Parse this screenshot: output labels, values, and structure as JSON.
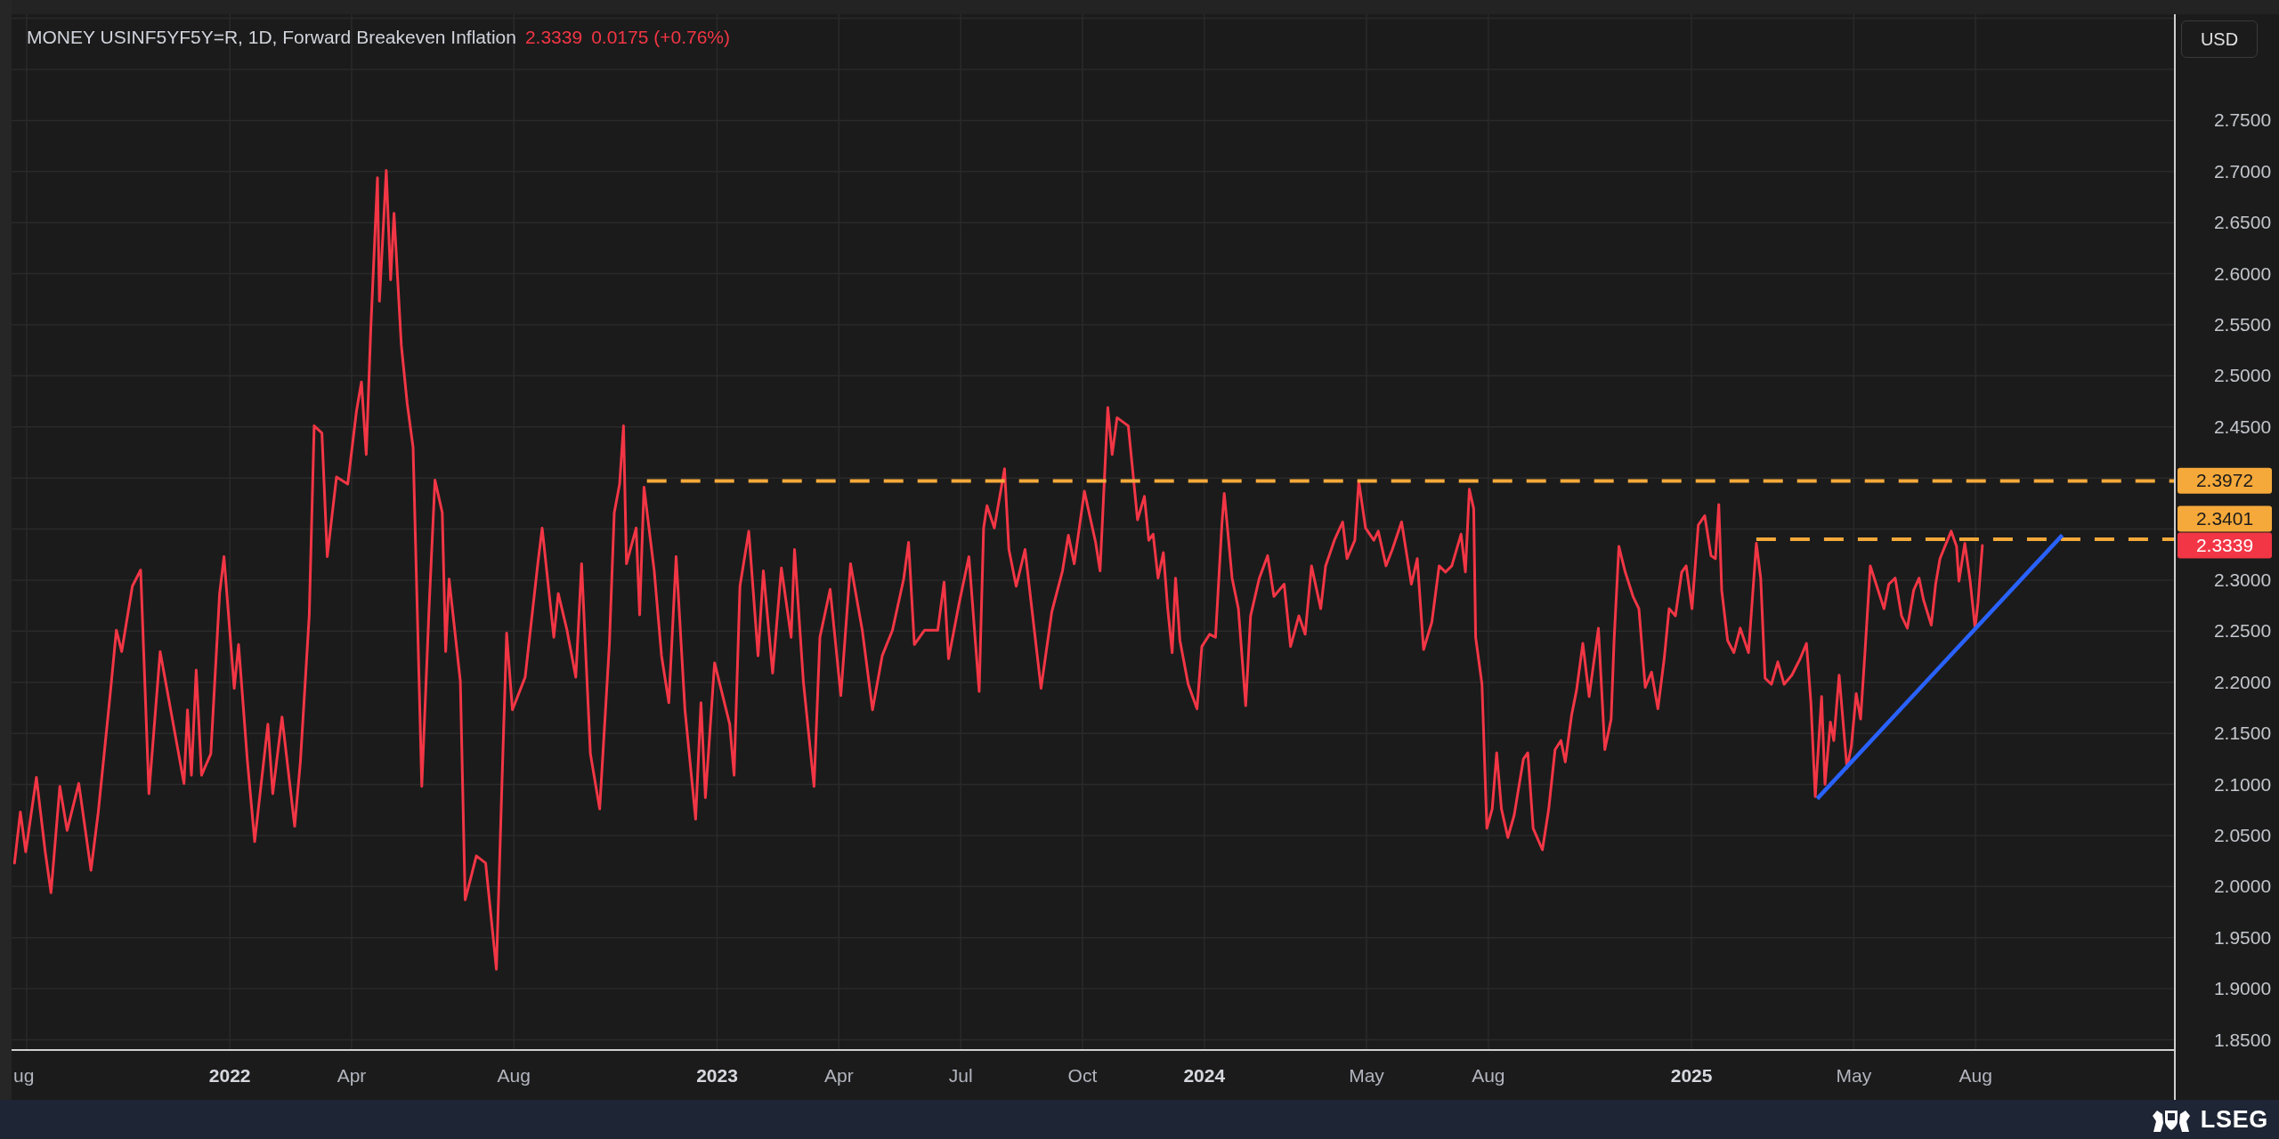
{
  "header": {
    "title": "MONEY USINF5YF5Y=R, 1D, Forward Breakeven Inflation",
    "last": "2.3339",
    "change": "0.0175 (+0.76%)"
  },
  "currency_button": "USD",
  "chart": {
    "chart_data": {
      "type": "line",
      "x": [
        2021.558,
        2021.57,
        2021.581,
        2021.603,
        2021.621,
        2021.633,
        2021.651,
        2021.666,
        2021.69,
        2021.715,
        2021.73,
        2021.755,
        2021.767,
        2021.778,
        2021.8,
        2021.817,
        2021.834,
        2021.857,
        2021.876,
        2021.906,
        2021.913,
        2021.921,
        2021.931,
        2021.942,
        2021.961,
        2021.979,
        2021.988,
        2022.009,
        2022.018,
        2022.036,
        2022.051,
        2022.078,
        2022.088,
        2022.107,
        2022.133,
        2022.145,
        2022.163,
        2022.173,
        2022.189,
        2022.2,
        2022.219,
        2022.242,
        2022.26,
        2022.27,
        2022.28,
        2022.289,
        2022.303,
        2022.307,
        2022.321,
        2022.33,
        2022.337,
        2022.352,
        2022.364,
        2022.376,
        2022.394,
        2022.409,
        2022.421,
        2022.436,
        2022.443,
        2022.45,
        2022.473,
        2022.483,
        2022.506,
        2022.525,
        2022.547,
        2022.558,
        2022.568,
        2022.58,
        2022.606,
        2022.632,
        2022.641,
        2022.665,
        2022.674,
        2022.692,
        2022.71,
        2022.722,
        2022.74,
        2022.759,
        2022.779,
        2022.789,
        2022.8,
        2022.808,
        2022.814,
        2022.834,
        2022.841,
        2022.85,
        2022.871,
        2022.886,
        2022.901,
        2022.916,
        2022.934,
        2022.956,
        2022.967,
        2022.976,
        2022.995,
        2023.026,
        2023.035,
        2023.047,
        2023.065,
        2023.084,
        2023.095,
        2023.114,
        2023.132,
        2023.152,
        2023.159,
        2023.177,
        2023.199,
        2023.211,
        2023.232,
        2023.254,
        2023.274,
        2023.298,
        2023.319,
        2023.339,
        2023.36,
        2023.383,
        2023.393,
        2023.405,
        2023.426,
        2023.453,
        2023.466,
        2023.475,
        2023.498,
        2023.517,
        2023.538,
        2023.547,
        2023.554,
        2023.569,
        2023.59,
        2023.599,
        2023.614,
        2023.632,
        2023.665,
        2023.687,
        2023.709,
        2023.721,
        2023.733,
        2023.754,
        2023.777,
        2023.786,
        2023.802,
        2023.811,
        2023.821,
        2023.844,
        2023.863,
        2023.877,
        2023.886,
        2023.895,
        2023.905,
        2023.916,
        2023.925,
        2023.934,
        2023.941,
        2023.95,
        2023.967,
        2023.985,
        2023.995,
        2024.011,
        2024.023,
        2024.036,
        2024.041,
        2024.057,
        2024.07,
        2024.085,
        2024.095,
        2024.113,
        2024.13,
        2024.143,
        2024.164,
        2024.177,
        2024.194,
        2024.207,
        2024.22,
        2024.239,
        2024.249,
        2024.267,
        2024.284,
        2024.293,
        2024.309,
        2024.317,
        2024.331,
        2024.348,
        2024.357,
        2024.373,
        2024.386,
        2024.405,
        2024.425,
        2024.437,
        2024.45,
        2024.467,
        2024.482,
        2024.495,
        2024.508,
        2024.527,
        2024.536,
        2024.544,
        2024.553,
        2024.557,
        2024.57,
        2024.58,
        2024.591,
        2024.6,
        2024.61,
        2024.623,
        2024.636,
        2024.655,
        2024.664,
        2024.675,
        2024.694,
        2024.707,
        2024.72,
        2024.732,
        2024.741,
        2024.754,
        2024.764,
        2024.777,
        2024.79,
        2024.809,
        2024.822,
        2024.835,
        2024.841,
        2024.851,
        2024.864,
        2024.88,
        2024.892,
        2024.905,
        2024.918,
        2024.931,
        2024.944,
        2024.954,
        2024.967,
        2024.98,
        2024.989,
        2025.001,
        2025.014,
        2025.027,
        2025.04,
        2025.049,
        2025.056,
        2025.062,
        2025.074,
        2025.087,
        2025.1,
        2025.117,
        2025.133,
        2025.142,
        2025.151,
        2025.164,
        2025.177,
        2025.19,
        2025.206,
        2025.223,
        2025.236,
        2025.245,
        2025.254,
        2025.267,
        2025.274,
        2025.285,
        2025.292,
        2025.303,
        2025.319,
        2025.328,
        2025.338,
        2025.347,
        2025.356,
        2025.367,
        2025.379,
        2025.395,
        2025.405,
        2025.418,
        2025.431,
        2025.443,
        2025.456,
        2025.467,
        2025.476,
        2025.492,
        2025.501,
        2025.51,
        2025.52,
        2025.533,
        2025.544,
        2025.549,
        2025.561,
        2025.572,
        2025.582,
        2025.588,
        2025.597
      ],
      "series": [
        {
          "color": "#f23645",
          "values": [
            2.023,
            2.073,
            2.034,
            2.107,
            2.034,
            1.994,
            2.098,
            2.055,
            2.101,
            2.016,
            2.073,
            2.191,
            2.251,
            2.23,
            2.294,
            2.31,
            2.091,
            2.23,
            2.18,
            2.101,
            2.173,
            2.109,
            2.212,
            2.109,
            2.13,
            2.287,
            2.323,
            2.194,
            2.237,
            2.123,
            2.044,
            2.159,
            2.091,
            2.166,
            2.059,
            2.123,
            2.266,
            2.451,
            2.444,
            2.323,
            2.401,
            2.394,
            2.466,
            2.494,
            2.423,
            2.544,
            2.694,
            2.573,
            2.701,
            2.594,
            2.659,
            2.53,
            2.473,
            2.43,
            2.098,
            2.273,
            2.398,
            2.366,
            2.23,
            2.301,
            2.201,
            1.987,
            2.03,
            2.023,
            1.919,
            2.094,
            2.248,
            2.173,
            2.205,
            2.316,
            2.351,
            2.244,
            2.287,
            2.251,
            2.205,
            2.316,
            2.13,
            2.076,
            2.237,
            2.366,
            2.394,
            2.451,
            2.316,
            2.351,
            2.266,
            2.391,
            2.309,
            2.226,
            2.18,
            2.323,
            2.173,
            2.066,
            2.18,
            2.087,
            2.219,
            2.159,
            2.109,
            2.294,
            2.348,
            2.226,
            2.309,
            2.209,
            2.312,
            2.244,
            2.33,
            2.201,
            2.098,
            2.244,
            2.291,
            2.187,
            2.316,
            2.251,
            2.173,
            2.226,
            2.251,
            2.301,
            2.337,
            2.237,
            2.251,
            2.251,
            2.298,
            2.223,
            2.28,
            2.323,
            2.191,
            2.351,
            2.373,
            2.351,
            2.409,
            2.33,
            2.294,
            2.33,
            2.194,
            2.269,
            2.309,
            2.344,
            2.316,
            2.387,
            2.337,
            2.309,
            2.469,
            2.423,
            2.459,
            2.451,
            2.359,
            2.382,
            2.339,
            2.345,
            2.302,
            2.327,
            2.272,
            2.229,
            2.302,
            2.241,
            2.198,
            2.174,
            2.235,
            2.247,
            2.244,
            2.354,
            2.385,
            2.302,
            2.272,
            2.177,
            2.265,
            2.302,
            2.324,
            2.284,
            2.296,
            2.235,
            2.265,
            2.247,
            2.314,
            2.272,
            2.314,
            2.339,
            2.357,
            2.321,
            2.339,
            2.397,
            2.351,
            2.339,
            2.348,
            2.314,
            2.33,
            2.357,
            2.296,
            2.321,
            2.232,
            2.259,
            2.314,
            2.308,
            2.314,
            2.345,
            2.308,
            2.389,
            2.37,
            2.244,
            2.198,
            2.057,
            2.076,
            2.131,
            2.076,
            2.048,
            2.07,
            2.125,
            2.131,
            2.057,
            2.036,
            2.076,
            2.134,
            2.143,
            2.122,
            2.168,
            2.192,
            2.238,
            2.186,
            2.253,
            2.134,
            2.164,
            2.241,
            2.333,
            2.308,
            2.284,
            2.272,
            2.195,
            2.21,
            2.174,
            2.223,
            2.272,
            2.265,
            2.308,
            2.314,
            2.272,
            2.354,
            2.363,
            2.324,
            2.321,
            2.374,
            2.29,
            2.241,
            2.229,
            2.253,
            2.229,
            2.336,
            2.302,
            2.204,
            2.198,
            2.22,
            2.198,
            2.207,
            2.223,
            2.238,
            2.18,
            2.088,
            2.186,
            2.1,
            2.161,
            2.143,
            2.207,
            2.116,
            2.137,
            2.189,
            2.164,
            2.229,
            2.314,
            2.296,
            2.272,
            2.296,
            2.302,
            2.265,
            2.253,
            2.29,
            2.302,
            2.281,
            2.256,
            2.296,
            2.321,
            2.333,
            2.348,
            2.333,
            2.299,
            2.336,
            2.299,
            2.253,
            2.278,
            2.334
          ]
        },
        {
          "color": "#f5a93a",
          "line_style": "dashed",
          "x": [
            2022.856,
            2025.992
          ],
          "values": [
            2.3972,
            2.3972
          ]
        },
        {
          "color": "#f5a93a",
          "line_style": "dashed",
          "x": [
            2025.133,
            2025.992
          ],
          "values": [
            2.3401,
            2.3401
          ]
        },
        {
          "color": "#2962ff",
          "x": [
            2025.258,
            2025.761
          ],
          "values": [
            2.086,
            2.344
          ]
        }
      ],
      "xlim": [
        2021.552,
        2025.992
      ],
      "ylim": [
        1.84,
        2.854
      ],
      "xticks": [
        {
          "value": 2021.583,
          "label": "ug"
        },
        {
          "value": 2022,
          "label": "2022"
        },
        {
          "value": 2022.25,
          "label": "Apr"
        },
        {
          "value": 2022.583,
          "label": "Aug"
        },
        {
          "value": 2023,
          "label": "2023"
        },
        {
          "value": 2023.25,
          "label": "Apr"
        },
        {
          "value": 2023.5,
          "label": "Jul"
        },
        {
          "value": 2023.75,
          "label": "Oct"
        },
        {
          "value": 2024,
          "label": "2024"
        },
        {
          "value": 2024.333,
          "label": "May"
        },
        {
          "value": 2024.583,
          "label": "Aug"
        },
        {
          "value": 2025,
          "label": "2025"
        },
        {
          "value": 2025.333,
          "label": "May"
        },
        {
          "value": 2025.583,
          "label": "Aug"
        }
      ],
      "yticks": [
        {
          "value": 1.85,
          "label": "1.8500"
        },
        {
          "value": 1.9,
          "label": "1.9000"
        },
        {
          "value": 1.95,
          "label": "1.9500"
        },
        {
          "value": 2.0,
          "label": "2.0000"
        },
        {
          "value": 2.05,
          "label": "2.0500"
        },
        {
          "value": 2.1,
          "label": "2.1000"
        },
        {
          "value": 2.15,
          "label": "2.1500"
        },
        {
          "value": 2.2,
          "label": "2.2000"
        },
        {
          "value": 2.25,
          "label": "2.2500"
        },
        {
          "value": 2.3,
          "label": "2.3000"
        },
        {
          "value": 2.45,
          "label": "2.4500"
        },
        {
          "value": 2.5,
          "label": "2.5000"
        },
        {
          "value": 2.55,
          "label": "2.5500"
        },
        {
          "value": 2.6,
          "label": "2.6000"
        },
        {
          "value": 2.65,
          "label": "2.6500"
        },
        {
          "value": 2.7,
          "label": "2.7000"
        },
        {
          "value": 2.75,
          "label": "2.7500"
        }
      ],
      "grid": true,
      "value_labels": [
        "2.3972",
        "2.3401",
        "2.3339"
      ]
    }
  },
  "footer": {
    "brand": "LSEG"
  }
}
